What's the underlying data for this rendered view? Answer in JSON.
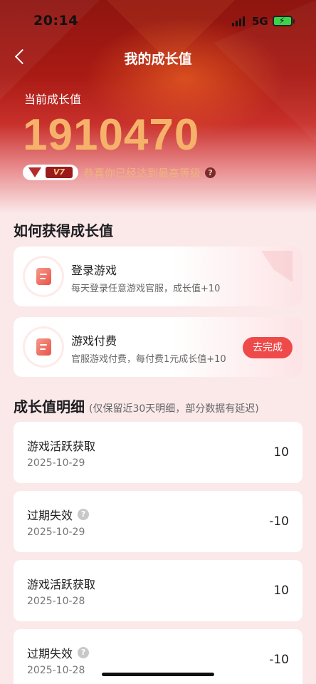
{
  "status_bar": {
    "time": "20:14",
    "network": "5G"
  },
  "nav": {
    "title": "我的成长值"
  },
  "summary": {
    "label": "当前成长值",
    "value": "1910470",
    "level_badge": "V7",
    "level_text": "恭喜你已经达到最高等级",
    "help_glyph": "?"
  },
  "how_to": {
    "title": "如何获得成长值",
    "tasks": [
      {
        "name": "登录游戏",
        "desc": "每天登录任意游戏官服，成长值+10",
        "button": ""
      },
      {
        "name": "游戏付费",
        "desc": "官服游戏付费，每付费1元成长值+10",
        "button": "去完成"
      }
    ]
  },
  "details": {
    "title": "成长值明细",
    "note": "(仅保留近30天明细，部分数据有延迟)",
    "records": [
      {
        "name": "游戏活跃获取",
        "date": "2025-10-29",
        "value": "10"
      },
      {
        "name": "过期失效",
        "date": "2025-10-29",
        "value": "-10",
        "help": "?"
      },
      {
        "name": "游戏活跃获取",
        "date": "2025-10-28",
        "value": "10"
      },
      {
        "name": "过期失效",
        "date": "2025-10-28",
        "value": "-10",
        "help": "?"
      }
    ]
  },
  "icons": [
    "back-arrow-icon",
    "signal-icon",
    "battery-charging-icon",
    "question-circle-icon",
    "task-document-icon",
    "crown-gem-icon"
  ],
  "colors": {
    "accent": "#ef4a4a",
    "value_gold": "#f6b26b",
    "level_text": "#f0b47a",
    "hero_top": "#8e1510"
  }
}
